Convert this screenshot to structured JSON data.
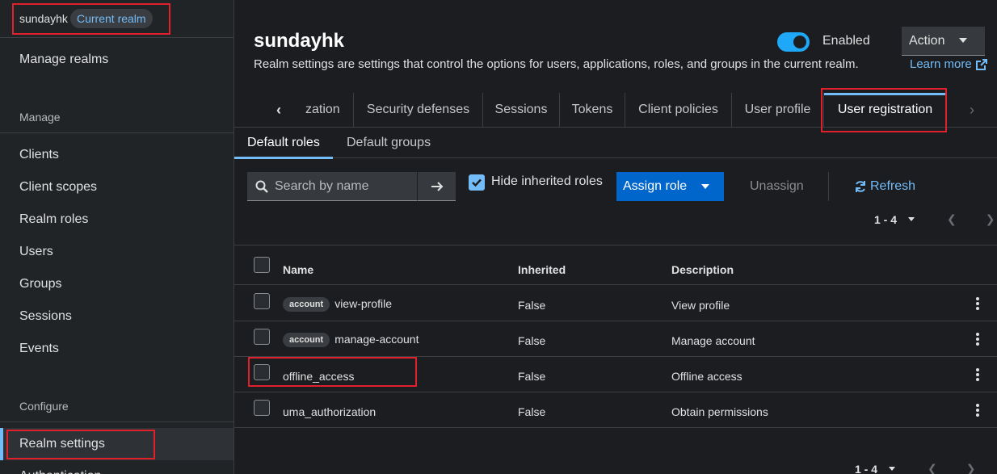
{
  "realm": {
    "name": "sundayhk",
    "badge": "Current realm"
  },
  "sidebar": {
    "manage_realms": "Manage realms",
    "section_manage": "Manage",
    "manage_items": [
      "Clients",
      "Client scopes",
      "Realm roles",
      "Users",
      "Groups",
      "Sessions",
      "Events"
    ],
    "section_configure": "Configure",
    "configure_items": [
      "Realm settings",
      "Authentication"
    ]
  },
  "header": {
    "title": "sundayhk",
    "description": "Realm settings are settings that control the options for users, applications, roles, and groups in the current realm.",
    "learn_more": "Learn more",
    "enabled_label": "Enabled",
    "enabled": true,
    "action_label": "Action"
  },
  "tabs": [
    "zation",
    "Security defenses",
    "Sessions",
    "Tokens",
    "Client policies",
    "User profile",
    "User registration"
  ],
  "active_tab": "User registration",
  "subtabs": [
    "Default roles",
    "Default groups"
  ],
  "toolbar": {
    "search_placeholder": "Search by name",
    "hide_inherited_label": "Hide inherited roles",
    "hide_inherited_checked": true,
    "assign_label": "Assign role",
    "unassign_label": "Unassign",
    "refresh_label": "Refresh"
  },
  "pagination": {
    "range": "1 - 4"
  },
  "table": {
    "columns": [
      "Name",
      "Inherited",
      "Description"
    ],
    "rows": [
      {
        "client": "account",
        "name": "view-profile",
        "inherited": "False",
        "description": "View profile"
      },
      {
        "client": "account",
        "name": "manage-account",
        "inherited": "False",
        "description": "Manage account"
      },
      {
        "client": "",
        "name": "offline_access",
        "inherited": "False",
        "description": "Offline access"
      },
      {
        "client": "",
        "name": "uma_authorization",
        "inherited": "False",
        "description": "Obtain permissions"
      }
    ]
  },
  "colors": {
    "accent": "#73bcf7",
    "primary": "#0066cc",
    "highlight": "#e0202a"
  }
}
